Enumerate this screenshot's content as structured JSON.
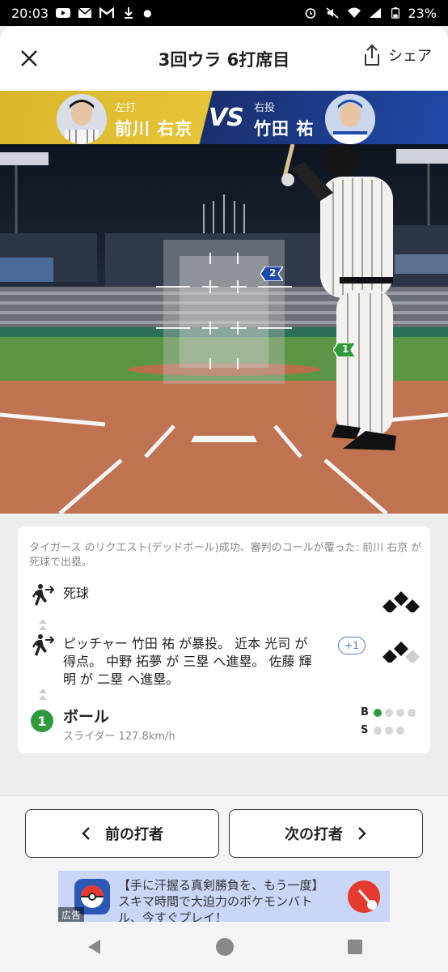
{
  "status_bar": {
    "time": "20:03",
    "battery_percent": "23%"
  },
  "header": {
    "title": "3回ウラ 6打席目",
    "share_label": "シェア"
  },
  "matchup": {
    "batter": {
      "role": "左打",
      "name": "前川 右京"
    },
    "vs": "VS",
    "pitcher": {
      "role": "右投",
      "name": "竹田 祐"
    }
  },
  "strike_zone": {
    "pitches": [
      {
        "number": "2",
        "color": "#1f4aa8"
      },
      {
        "number": "1",
        "color": "#2e9a3c"
      }
    ]
  },
  "play_log": {
    "note": "タイガース のリクエスト(デッドボール)成功、審判のコールが覆った: 前川 右京 が死球で出塁。",
    "events": [
      {
        "text": "死球"
      },
      {
        "text_lines": [
          "ピッチャー 竹田 祐 が暴投。 近本 光司 が",
          "得点。 中野 拓夢 が 三塁 へ進塁。 佐藤 輝",
          "明 が 二塁 へ進塁。"
        ],
        "badge": "+1"
      }
    ],
    "pitch": {
      "number": "1",
      "result": "ボール",
      "detail": "スライダー 127.8km/h"
    },
    "count": {
      "balls_label": "B",
      "strikes_label": "S",
      "balls": 1,
      "strikes": 0
    }
  },
  "navigation": {
    "prev_label": "前の打者",
    "next_label": "次の打者"
  },
  "ad": {
    "line1": "【手に汗握る真剣勝負を、もう一度】",
    "line2": "スキマ時間で大迫力のポケモンバト",
    "line3": "ル、今すぐプレイ！",
    "label": "広告"
  }
}
